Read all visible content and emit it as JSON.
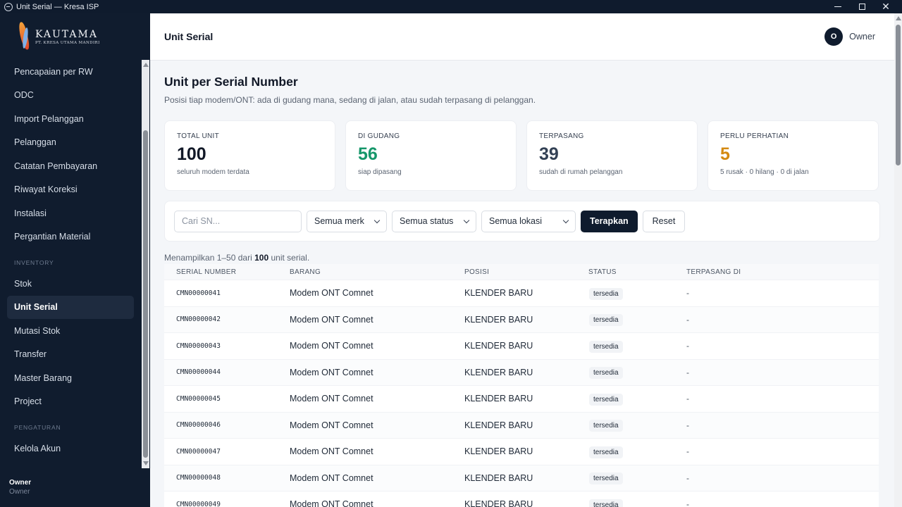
{
  "window": {
    "title": "Unit Serial — Kresa ISP"
  },
  "brand": {
    "name": "KAUTAMA",
    "subtitle": "PT. KRESA UTAMA MANDIRI"
  },
  "sidebar": {
    "items": [
      {
        "label": "Pencapaian per RW"
      },
      {
        "label": "ODC"
      },
      {
        "label": "Import Pelanggan"
      },
      {
        "label": "Pelanggan"
      },
      {
        "label": "Catatan Pembayaran"
      },
      {
        "label": "Riwayat Koreksi"
      },
      {
        "label": "Instalasi"
      },
      {
        "label": "Pergantian Material"
      }
    ],
    "section_inventory": "INVENTORY",
    "inventory_items": [
      {
        "label": "Stok"
      },
      {
        "label": "Unit Serial"
      },
      {
        "label": "Mutasi Stok"
      },
      {
        "label": "Transfer"
      },
      {
        "label": "Master Barang"
      },
      {
        "label": "Project"
      }
    ],
    "section_settings": "PENGATURAN",
    "settings_items": [
      {
        "label": "Kelola Akun"
      }
    ],
    "user": {
      "name": "Owner",
      "role": "Owner"
    }
  },
  "header": {
    "title": "Unit Serial",
    "avatar_initial": "O",
    "user_name": "Owner"
  },
  "page": {
    "title": "Unit per Serial Number",
    "subtitle": "Posisi tiap modem/ONT: ada di gudang mana, sedang di jalan, atau sudah terpasang di pelanggan."
  },
  "stats": [
    {
      "label": "TOTAL UNIT",
      "value": "100",
      "note": "seluruh modem terdata",
      "color": "#111827"
    },
    {
      "label": "DI GUDANG",
      "value": "56",
      "note": "siap dipasang",
      "color": "#16976a"
    },
    {
      "label": "TERPASANG",
      "value": "39",
      "note": "sudah di rumah pelanggan",
      "color": "#334155"
    },
    {
      "label": "PERLU PERHATIAN",
      "value": "5",
      "note": "5 rusak · 0 hilang · 0 di jalan",
      "color": "#d48a12"
    }
  ],
  "filters": {
    "search_placeholder": "Cari SN...",
    "brand_select": "Semua merk",
    "status_select": "Semua status",
    "location_select": "Semua lokasi",
    "apply_label": "Terapkan",
    "reset_label": "Reset"
  },
  "summary": {
    "prefix": "Menampilkan 1–50 dari",
    "total": "100",
    "suffix": "unit serial."
  },
  "table": {
    "columns": [
      "SERIAL NUMBER",
      "BARANG",
      "POSISI",
      "STATUS",
      "TERPASANG DI"
    ],
    "rows": [
      {
        "sn": "CMN00000041",
        "item": "Modem ONT Comnet",
        "position": "KLENDER BARU",
        "status": "tersedia",
        "installed_at": "-"
      },
      {
        "sn": "CMN00000042",
        "item": "Modem ONT Comnet",
        "position": "KLENDER BARU",
        "status": "tersedia",
        "installed_at": "-"
      },
      {
        "sn": "CMN00000043",
        "item": "Modem ONT Comnet",
        "position": "KLENDER BARU",
        "status": "tersedia",
        "installed_at": "-"
      },
      {
        "sn": "CMN00000044",
        "item": "Modem ONT Comnet",
        "position": "KLENDER BARU",
        "status": "tersedia",
        "installed_at": "-"
      },
      {
        "sn": "CMN00000045",
        "item": "Modem ONT Comnet",
        "position": "KLENDER BARU",
        "status": "tersedia",
        "installed_at": "-"
      },
      {
        "sn": "CMN00000046",
        "item": "Modem ONT Comnet",
        "position": "KLENDER BARU",
        "status": "tersedia",
        "installed_at": "-"
      },
      {
        "sn": "CMN00000047",
        "item": "Modem ONT Comnet",
        "position": "KLENDER BARU",
        "status": "tersedia",
        "installed_at": "-"
      },
      {
        "sn": "CMN00000048",
        "item": "Modem ONT Comnet",
        "position": "KLENDER BARU",
        "status": "tersedia",
        "installed_at": "-"
      },
      {
        "sn": "CMN00000049",
        "item": "Modem ONT Comnet",
        "position": "KLENDER BARU",
        "status": "tersedia",
        "installed_at": "-"
      }
    ]
  }
}
